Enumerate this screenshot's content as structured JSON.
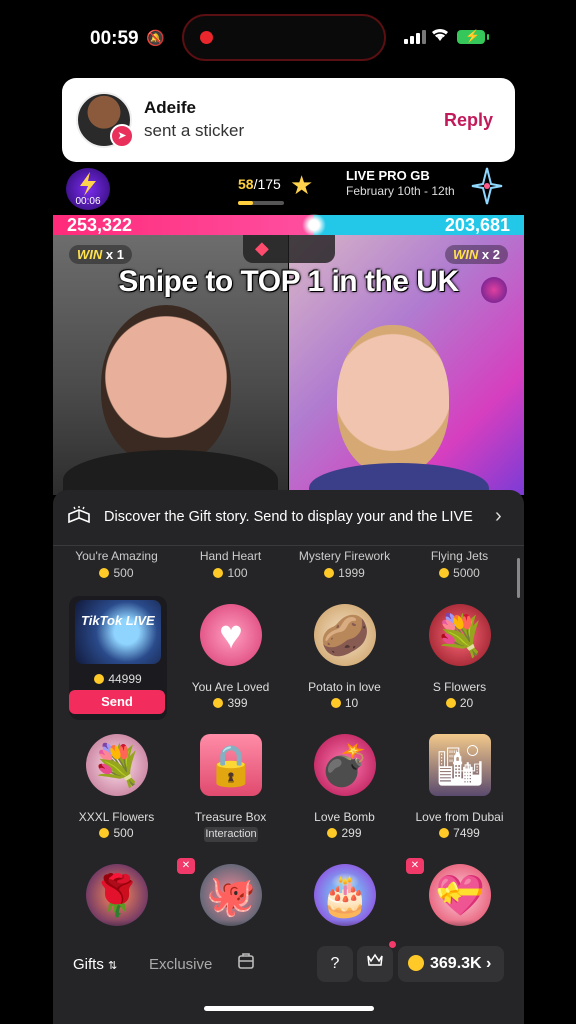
{
  "status_bar": {
    "time": "00:59"
  },
  "notification": {
    "name": "Adeife",
    "message": "sent a sticker",
    "action": "Reply"
  },
  "live_header": {
    "badge_time": "00:06",
    "counter_current": "58",
    "counter_total": "/175",
    "progress": 0.33,
    "pro_title": "LIVE PRO GB",
    "pro_dates": "February 10th - 12th"
  },
  "battle": {
    "score_left": "253,322",
    "score_right": "203,681",
    "left_share": 0.554,
    "win_left_label": "WIN",
    "win_left_count": "x 1",
    "win_right_label": "WIN",
    "win_right_count": "x 2",
    "caption": "Snipe to TOP 1 in the UK"
  },
  "gift_panel": {
    "discover_text": "Discover the Gift story. Send to display your and the LIVE",
    "top_row": [
      {
        "name": "You're Amazing",
        "price": "500"
      },
      {
        "name": "Hand Heart",
        "price": "100"
      },
      {
        "name": "Mystery Firework",
        "price": "1999"
      },
      {
        "name": "Flying Jets",
        "price": "5000"
      }
    ],
    "selected": {
      "logo_text": "TikTok LIVE",
      "price": "44999",
      "send_label": "Send"
    },
    "row1": [
      {
        "name": "You Are Loved",
        "price": "399"
      },
      {
        "name": "Potato in love",
        "price": "10"
      },
      {
        "name": "S Flowers",
        "price": "20"
      }
    ],
    "row2": [
      {
        "name": "XXXL Flowers",
        "price": "500"
      },
      {
        "name": "Treasure Box",
        "tag": "Interaction"
      },
      {
        "name": "Love Bomb",
        "price": "299"
      },
      {
        "name": "Love from Dubai",
        "price": "7499"
      }
    ],
    "bottom": {
      "tab_gifts": "Gifts",
      "tab_exclusive": "Exclusive",
      "coins": "369.3K"
    }
  },
  "colors": {
    "accent": "#f22c5c",
    "coin": "#ffc928",
    "reply": "#c2195a",
    "left_team": "#ff2a7a",
    "right_team": "#23c8e8"
  }
}
